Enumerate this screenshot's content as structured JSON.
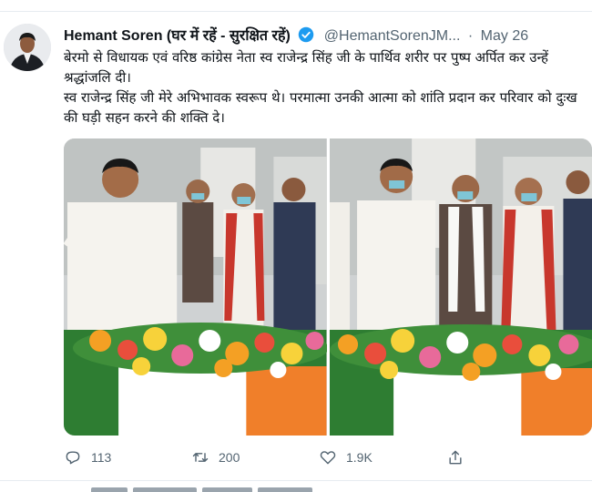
{
  "tweet": {
    "author_name": "Hemant Soren (घर में रहें - सुरक्षित रहें)",
    "handle": "@HemantSorenJM...",
    "separator": "·",
    "date": "May 26",
    "text_line1": "बेरमो से विधायक एवं वरिष्ठ कांग्रेस नेता स्व राजेन्द्र सिंह जी के पार्थिव शरीर पर पुष्प अर्पित कर उन्हें श्रद्धांजलि दी।",
    "text_line2": "स्व राजेन्द्र सिंह जी मेरे अभिभावक स्वरूप थे। परमात्मा उनकी आत्मा को शांति प्रदान कर परिवार को दुःख की घड़ी सहन करने की शक्ति दे।"
  },
  "media": {
    "photos": [
      {
        "subject": "leader-placing-flowers"
      },
      {
        "subject": "leader-standing-by-bier"
      }
    ]
  },
  "actions": {
    "reply_count": "113",
    "retweet_count": "200",
    "like_count": "1.9K",
    "share_label": ""
  },
  "colors": {
    "verified": "#1d9bf0",
    "muted_text": "#536471",
    "divider": "#e6ecf0",
    "flag_saffron": "#f07f2a",
    "flag_green": "#2e7d32"
  },
  "icons": [
    "verified-badge-icon",
    "reply-icon",
    "retweet-icon",
    "like-icon",
    "share-icon"
  ]
}
